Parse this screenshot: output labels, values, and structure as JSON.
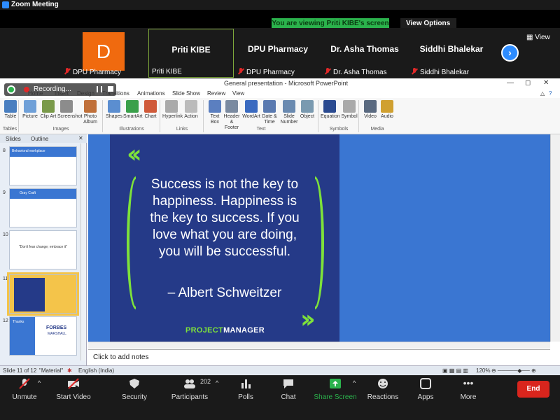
{
  "zoom": {
    "window_title": "Zoom Meeting",
    "share_banner": "You are viewing Priti KIBE's screen",
    "view_options": "View Options",
    "view_button": "View"
  },
  "participants": [
    {
      "name": "",
      "foot": "DPU Pharmacy",
      "avatar": "D",
      "muted": true
    },
    {
      "name": "Priti KIBE",
      "foot": "Priti KIBE",
      "muted": false
    },
    {
      "name": "DPU Pharmacy",
      "foot": "DPU Pharmacy",
      "muted": true
    },
    {
      "name": "Dr. Asha Thomas",
      "foot": "Dr. Asha Thomas",
      "muted": true
    },
    {
      "name": "Siddhi Bhalekar",
      "foot": "Siddhi Bhalekar",
      "muted": true
    }
  ],
  "recording": {
    "label": "Recording..."
  },
  "ppt": {
    "window_title": "General presentation - Microsoft PowerPoint",
    "menu": [
      "Home",
      "Insert",
      "Design",
      "Transitions",
      "Animations",
      "Slide Show",
      "Review",
      "View"
    ],
    "ribbon": [
      {
        "label": "Table",
        "color": "#4a7fc0"
      },
      {
        "label": "Picture",
        "color": "#6fa0d8"
      },
      {
        "label": "Clip Art",
        "color": "#7a9a4a"
      },
      {
        "label": "Screenshot",
        "color": "#8c8c8c"
      },
      {
        "label": "Photo Album",
        "color": "#c0703a"
      },
      {
        "label": "Shapes",
        "color": "#5b8ed0"
      },
      {
        "label": "SmartArt",
        "color": "#3aa04a"
      },
      {
        "label": "Chart",
        "color": "#d05a3a"
      },
      {
        "label": "Hyperlink",
        "color": "#aaaaaa"
      },
      {
        "label": "Action",
        "color": "#bbbbbb"
      },
      {
        "label": "Text Box",
        "color": "#5b7fc0"
      },
      {
        "label": "Header & Footer",
        "color": "#7a8aa0"
      },
      {
        "label": "WordArt",
        "color": "#3a6ac0"
      },
      {
        "label": "Date & Time",
        "color": "#5a7ab0"
      },
      {
        "label": "Slide Number",
        "color": "#6a8ab0"
      },
      {
        "label": "Object",
        "color": "#7a9ab0"
      },
      {
        "label": "Equation",
        "color": "#2a4a90"
      },
      {
        "label": "Symbol",
        "color": "#aaaaaa"
      },
      {
        "label": "Video",
        "color": "#5a6a80"
      },
      {
        "label": "Audio",
        "color": "#d0a030"
      }
    ],
    "groups": [
      "Tables",
      "Images",
      "Illustrations",
      "Links",
      "Text",
      "Symbols",
      "Media"
    ],
    "panel_tabs": [
      "Slides",
      "Outline"
    ],
    "thumbnails": [
      {
        "num": "8",
        "title": "Behavioral workplace"
      },
      {
        "num": "9",
        "title": "Gray   Craft"
      },
      {
        "num": "10",
        "title": "\"Don't fear change; embrace it\""
      },
      {
        "num": "11",
        "title": ""
      },
      {
        "num": "12",
        "title": "Thanks"
      }
    ],
    "slide": {
      "quote": "Success is not the key to happiness. Happiness is the key to success. If you love what you are doing, you will be successful.",
      "author": "– Albert Schweitzer",
      "brand_a": "PROJECT",
      "brand_b": "MANAGER"
    },
    "thumb12_brand": "FORBES",
    "thumb12_sub": "MARSHALL",
    "notes_placeholder": "Click to add notes",
    "status": {
      "slide": "Slide 11 of 12",
      "theme": "\"Material\"",
      "language": "English (India)",
      "zoom": "120%"
    }
  },
  "toolbar": {
    "unmute": "Unmute",
    "start_video": "Start Video",
    "security": "Security",
    "participants": "Participants",
    "participant_count": "202",
    "polls": "Polls",
    "chat": "Chat",
    "share_screen": "Share Screen",
    "reactions": "Reactions",
    "apps": "Apps",
    "more": "More",
    "end": "End"
  },
  "colors": {
    "accent": "#2d8cff",
    "share_green": "#2bb24c",
    "end_red": "#d9251d",
    "slide_bg": "#253a88",
    "quote_green": "#7ee23a"
  }
}
